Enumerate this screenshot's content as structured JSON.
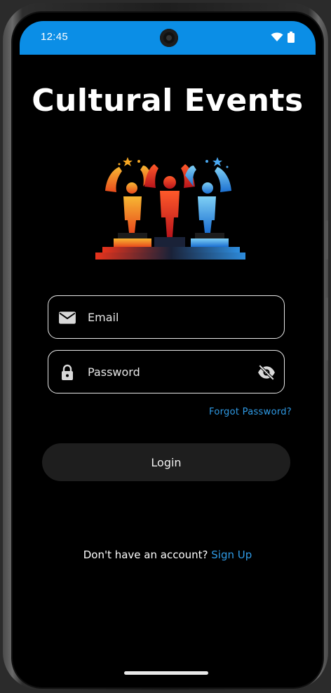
{
  "status_bar": {
    "time": "12:45",
    "background_color": "#0b8ee6",
    "icons": [
      "wifi-icon",
      "battery-icon"
    ]
  },
  "app": {
    "title": "Cultural Events",
    "logo": "three-trophy-figures-logo"
  },
  "form": {
    "email": {
      "placeholder": "Email",
      "value": "",
      "icon": "email-icon"
    },
    "password": {
      "placeholder": "Password",
      "value": "",
      "icon": "lock-icon",
      "toggle_icon": "visibility-off-icon"
    },
    "forgot_password": "Forgot Password?",
    "login_label": "Login"
  },
  "signup": {
    "prompt": "Don't have an account?",
    "link": "Sign Up"
  },
  "colors": {
    "accent": "#2f9be6",
    "background": "#000000",
    "button": "#1e1e1e"
  }
}
